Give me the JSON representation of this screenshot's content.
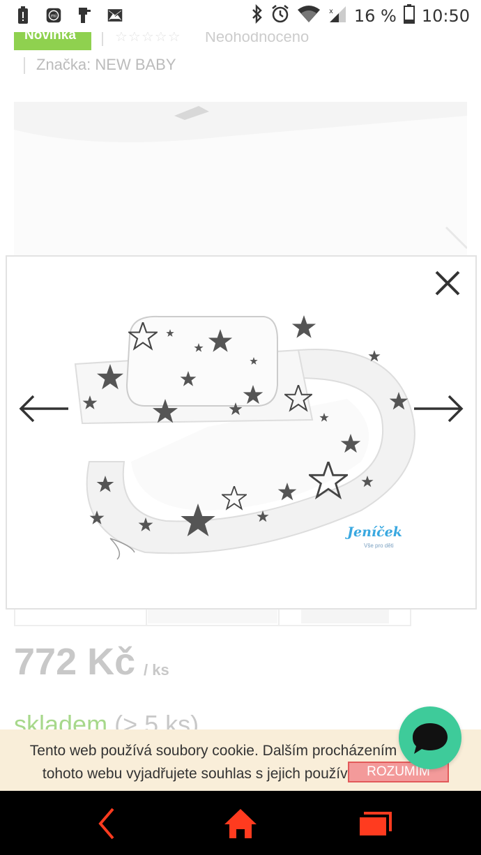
{
  "status_bar": {
    "battery_percent": "16 %",
    "time": "10:50",
    "icons": [
      "alert-icon",
      "mi-icon",
      "usb-icon",
      "image-icon",
      "bluetooth-icon",
      "alarm-icon",
      "wifi-icon",
      "signal-icon",
      "battery-icon"
    ]
  },
  "product": {
    "badge": "Novinka",
    "rating_stars": "☆☆☆☆☆",
    "rating_text": "Neohodnoceno",
    "brand_label": "Značka:",
    "brand_name": "NEW BABY",
    "price": "772 Kč",
    "unit": "/ ks",
    "stock_label": "skladem",
    "stock_qty": "(> 5 ks)"
  },
  "lightbox": {
    "close_icon": "close-icon",
    "prev_icon": "arrow-left-icon",
    "next_icon": "arrow-right-icon",
    "logo_text": "Jeníček",
    "logo_subtext": "Vše pro děti"
  },
  "cookie": {
    "text": "Tento web používá soubory cookie. Dalším procházením tohoto webu vyjadřujete souhlas s jejich používáním.",
    "accept_label": "ROZUMÍM"
  },
  "colors": {
    "badge_green": "#8fd14f",
    "chat_green": "#3ecb9a",
    "nav_red": "#ff3b1f",
    "cookie_bg": "#f9eed9",
    "accept_bg": "#f39a9a"
  },
  "navbar": {
    "icons": [
      "back-icon",
      "home-icon",
      "recents-icon"
    ]
  }
}
